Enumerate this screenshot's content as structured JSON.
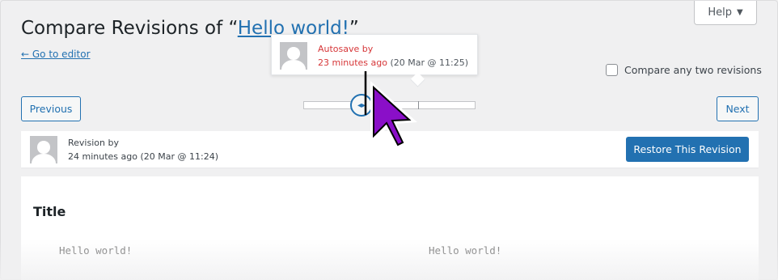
{
  "header": {
    "help_label": "Help",
    "title_prefix": "Compare Revisions of “",
    "title_link": "Hello world!",
    "title_suffix": "”",
    "go_to_editor": "← Go to editor",
    "compare_any_label": "Compare any two revisions"
  },
  "navigation": {
    "previous_label": "Previous",
    "next_label": "Next"
  },
  "tooltip": {
    "line1": "Autosave by",
    "time_ago": "23 minutes ago",
    "date": " (20 Mar @ 11:25)"
  },
  "revision": {
    "line1": "Revision by",
    "line2": "24 minutes ago (20 Mar @ 11:24)",
    "restore_label": "Restore This Revision"
  },
  "diff": {
    "field_title": "Title",
    "left_value": "Hello world!",
    "right_value": "Hello world!"
  },
  "colors": {
    "accent": "#2271b1",
    "autosave_red": "#d63638",
    "cursor_purple": "#8a0fc8"
  }
}
